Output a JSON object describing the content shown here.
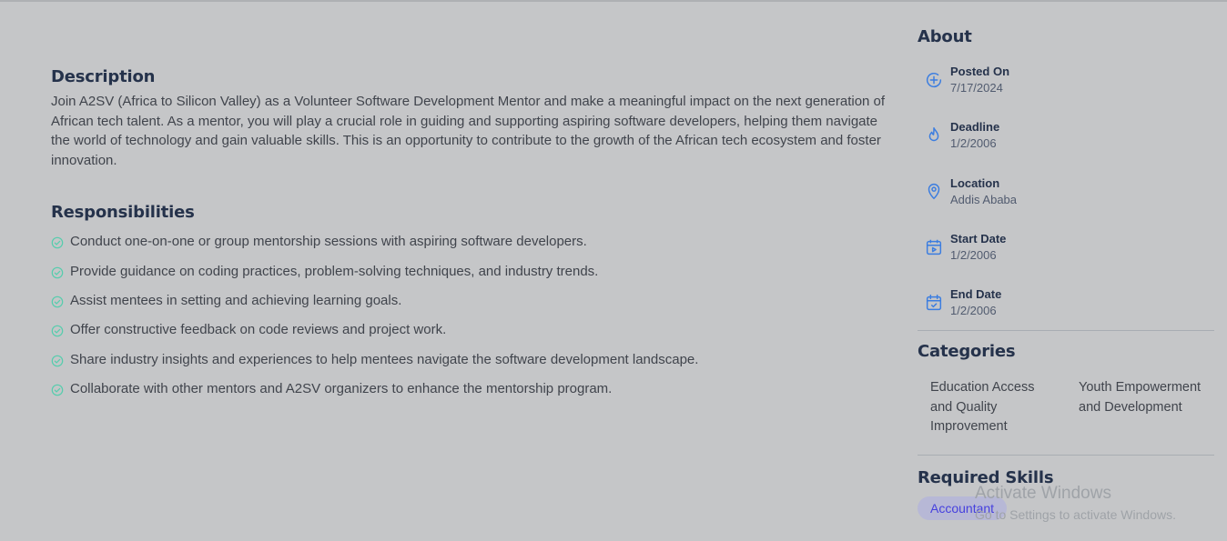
{
  "description": {
    "title": "Description",
    "text": "Join A2SV (Africa to Silicon Valley) as a Volunteer Software Development Mentor and make a meaningful impact on the next generation of African tech talent. As a mentor, you will play a crucial role in guiding and supporting aspiring software developers, helping them navigate the world of technology and gain valuable skills. This is an opportunity to contribute to the growth of the African tech ecosystem and foster innovation."
  },
  "responsibilities": {
    "title": "Responsibilities",
    "items": [
      "Conduct one-on-one or group mentorship sessions with aspiring software developers.",
      "Provide guidance on coding practices, problem-solving techniques, and industry trends.",
      "Assist mentees in setting and achieving learning goals.",
      "Offer constructive feedback on code reviews and project work.",
      "Share industry insights and experiences to help mentees navigate the software development landscape.",
      "Collaborate with other mentors and A2SV organizers to enhance the mentorship program."
    ]
  },
  "about": {
    "title": "About",
    "items": [
      {
        "label": "Posted On",
        "value": "7/17/2024",
        "icon": "plus-circle-icon"
      },
      {
        "label": "Deadline",
        "value": "1/2/2006",
        "icon": "fire-icon"
      },
      {
        "label": "Location",
        "value": "Addis Ababa",
        "icon": "location-pin-icon"
      },
      {
        "label": "Start Date",
        "value": "1/2/2006",
        "icon": "calendar-play-icon"
      },
      {
        "label": "End Date",
        "value": "1/2/2006",
        "icon": "calendar-check-icon"
      }
    ]
  },
  "categories": {
    "title": "Categories",
    "items": [
      "Education Access and Quality Improvement",
      "Youth Empowerment and Development"
    ]
  },
  "skills": {
    "title": "Required Skills",
    "items": [
      "Accountant"
    ]
  },
  "watermark": {
    "title": "Activate Windows",
    "subtitle": "Go to Settings to activate Windows."
  },
  "colors": {
    "accent": "#3b7de0",
    "check": "#56cdad",
    "skill_text": "#4640de",
    "overlay_bg": "#c5c6c8"
  }
}
